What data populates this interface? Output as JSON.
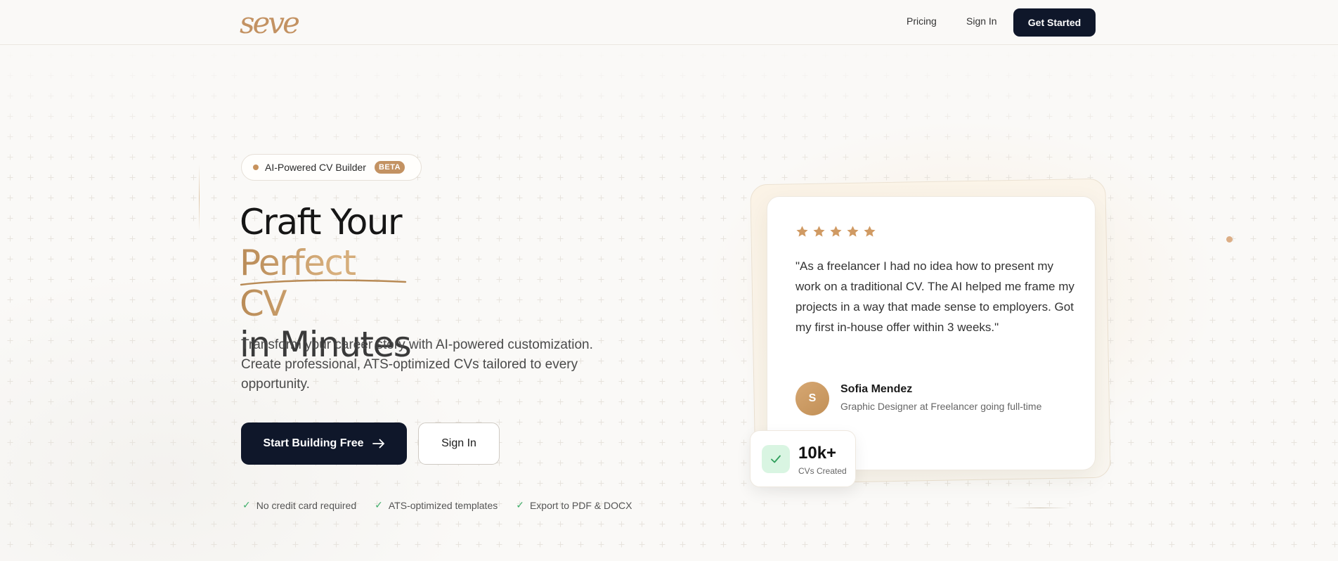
{
  "brand": {
    "logo_text": "seve",
    "accent": "#c39262",
    "dark": "#0f172a"
  },
  "nav": {
    "pricing": "Pricing",
    "sign_in": "Sign In",
    "get_started": "Get Started"
  },
  "hero": {
    "badge_text": "AI-Powered CV Builder",
    "badge_tag": "BETA",
    "title_line1": "Craft Your",
    "title_line2": "Perfect CV",
    "title_line3": "in Minutes",
    "subtitle": "Transform your career story with AI-powered customization. Create professional, ATS-optimized CVs tailored to every opportunity.",
    "primary_cta": "Start Building Free",
    "secondary_cta": "Sign In",
    "features": [
      "No credit card required",
      "ATS-optimized templates",
      "Export to PDF & DOCX"
    ]
  },
  "testimonial": {
    "rating": 5,
    "quote": "\"As a freelancer I had no idea how to present my work on a traditional CV. The AI helped me frame my projects in a way that made sense to employers. Got my first in-house offer within 3 weeks.\"",
    "avatar_initial": "S",
    "author_name": "Sofia Mendez",
    "author_role": "Graphic Designer at Freelancer going full-time"
  },
  "stat": {
    "value": "10k+",
    "label": "CVs Created"
  },
  "icons": [
    "check-icon",
    "arrow-right-icon",
    "star-icon"
  ]
}
